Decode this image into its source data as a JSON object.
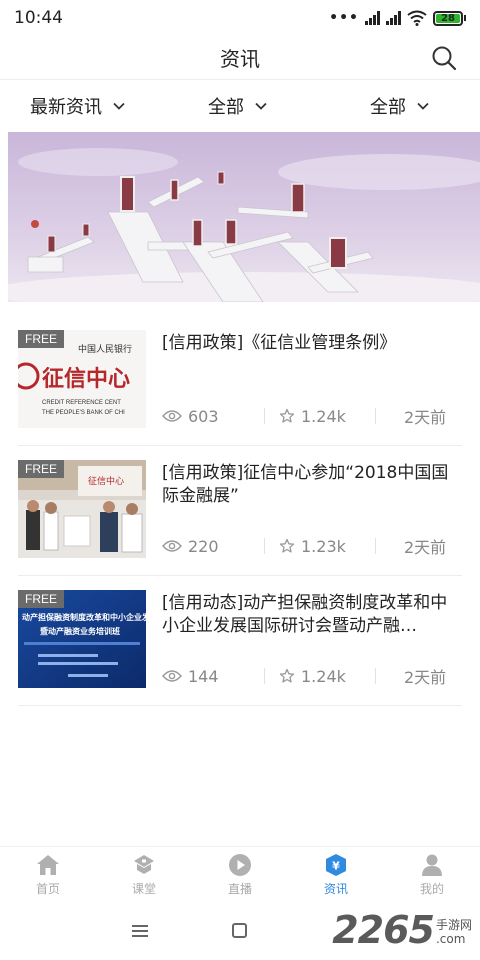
{
  "status_bar": {
    "time": "10:44",
    "battery": "28"
  },
  "header": {
    "title": "资讯"
  },
  "filters": [
    {
      "label": "最新资讯"
    },
    {
      "label": "全部"
    },
    {
      "label": "全部"
    }
  ],
  "news": [
    {
      "tag": "FREE",
      "title": "[信用政策]《征信业管理条例》",
      "views": "603",
      "likes": "1.24k",
      "time": "2天前",
      "thumb_text": "征信中心",
      "thumb_sub1": "中国人民银行",
      "thumb_sub2": "CREDIT REFERENCE CENT",
      "thumb_sub3": "THE PEOPLE'S BANK OF CHI"
    },
    {
      "tag": "FREE",
      "title": "[信用政策]征信中心参加“2018中国国际金融展”",
      "views": "220",
      "likes": "1.23k",
      "time": "2天前",
      "thumb_text": "征信中心"
    },
    {
      "tag": "FREE",
      "title": "[信用动态]动产担保融资制度改革和中小企业发展国际研讨会暨动产融…",
      "views": "144",
      "likes": "1.24k",
      "time": "2天前",
      "thumb_text": "动产担保融资制度改革和中小企业发展国际研讨会",
      "thumb_sub1": "暨动产融资业务培训班"
    }
  ],
  "bottom_nav": [
    {
      "label": "首页",
      "icon": "home-icon"
    },
    {
      "label": "课堂",
      "icon": "classroom-icon"
    },
    {
      "label": "直播",
      "icon": "live-icon"
    },
    {
      "label": "资讯",
      "icon": "news-icon",
      "active": true
    },
    {
      "label": "我的",
      "icon": "profile-icon"
    }
  ],
  "watermark": {
    "number": "2265",
    "line1": "手游网",
    "line2": ".com"
  },
  "colors": {
    "accent": "#2f8ae0",
    "free_tag": "#6b6b6b",
    "inactive": "#aaaaaa"
  }
}
